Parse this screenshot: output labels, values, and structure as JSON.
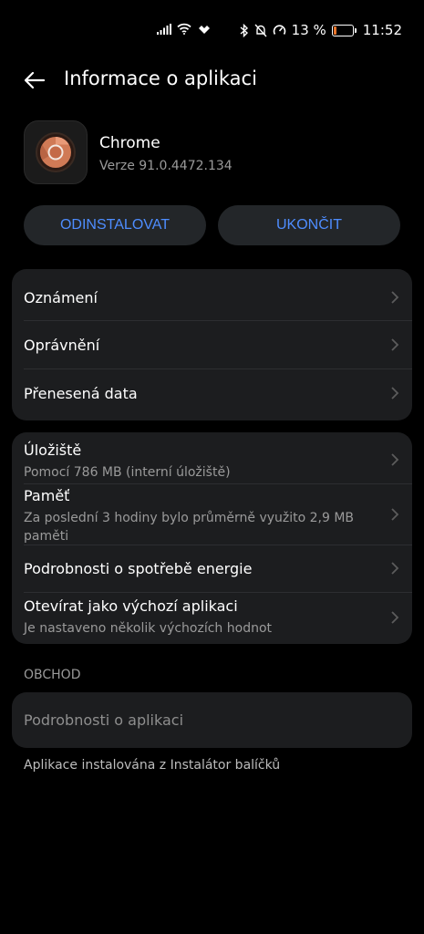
{
  "status_bar": {
    "battery_percent": "13 %",
    "time": "11:52",
    "battery_color": "#e8742a"
  },
  "header": {
    "title": "Informace o aplikaci"
  },
  "app": {
    "name": "Chrome",
    "version": "Verze 91.0.4472.134",
    "icon": "chrome-icon"
  },
  "actions": {
    "uninstall_label": "ODINSTALOVAT",
    "stop_label": "UKONČIT",
    "accent_color": "#4e8dff"
  },
  "group1": {
    "items": [
      {
        "title": "Oznámení"
      },
      {
        "title": "Oprávnění"
      },
      {
        "title": "Přenesená data"
      }
    ]
  },
  "group2": {
    "items": [
      {
        "title": "Úložiště",
        "subtitle": "Pomocí 786 MB (interní úložiště)"
      },
      {
        "title": "Paměť",
        "subtitle": "Za poslední 3 hodiny bylo průměrně využito 2,9 MB paměti"
      },
      {
        "title": "Podrobnosti o spotřebě energie"
      },
      {
        "title": "Otevírat jako výchozí aplikaci",
        "subtitle": "Je nastaveno několik výchozích hodnot"
      }
    ]
  },
  "store": {
    "section_label": "OBCHOD",
    "details_label": "Podrobnosti o aplikaci",
    "install_note": "Aplikace instalována z Instalátor balíčků"
  }
}
